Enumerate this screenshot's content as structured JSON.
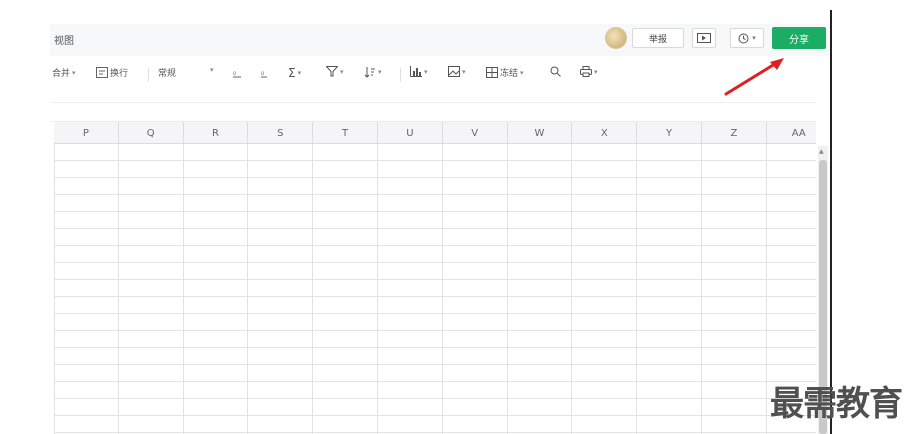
{
  "titlebar": {
    "menu_view": "视图",
    "report_label": "举报",
    "share_label": "分享",
    "history_caret": "▾",
    "accent_color": "#1aad63"
  },
  "toolbar": {
    "merge_label": "合并",
    "wrap_label": "换行",
    "format_label": "常规",
    "sum_label": "Σ",
    "freeze_label": "冻结"
  },
  "columns": [
    "P",
    "Q",
    "R",
    "S",
    "T",
    "U",
    "V",
    "W",
    "X",
    "Y",
    "Z",
    "AA"
  ],
  "watermark": "最需教育",
  "annotation": {
    "arrow_color": "#e02020"
  }
}
